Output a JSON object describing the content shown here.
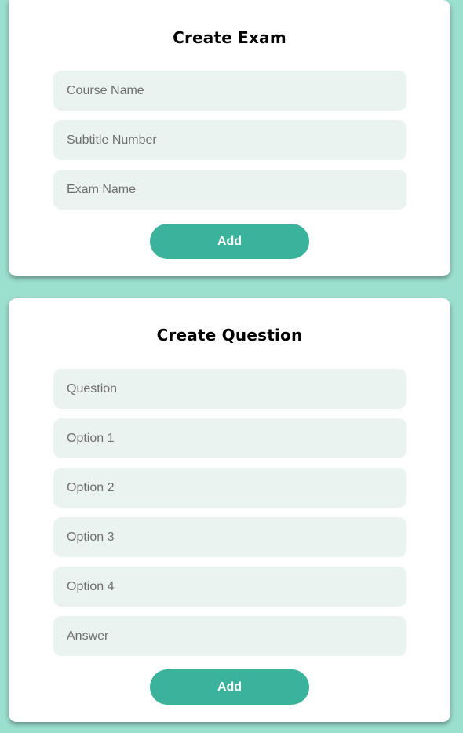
{
  "colors": {
    "page_background": "#9bdfcf",
    "card_background": "#ffffff",
    "field_background": "#eaf3f0",
    "button_background": "#3bb29c",
    "button_text": "#ffffff"
  },
  "exam_form": {
    "title": "Create Exam",
    "fields": [
      {
        "placeholder": "Course Name",
        "value": ""
      },
      {
        "placeholder": "Subtitle Number",
        "value": ""
      },
      {
        "placeholder": "Exam Name",
        "value": ""
      }
    ],
    "submit_label": "Add"
  },
  "question_form": {
    "title": "Create Question",
    "fields": [
      {
        "placeholder": "Question",
        "value": ""
      },
      {
        "placeholder": "Option 1",
        "value": ""
      },
      {
        "placeholder": "Option 2",
        "value": ""
      },
      {
        "placeholder": "Option 3",
        "value": ""
      },
      {
        "placeholder": "Option 4",
        "value": ""
      },
      {
        "placeholder": "Answer",
        "value": ""
      }
    ],
    "submit_label": "Add"
  }
}
